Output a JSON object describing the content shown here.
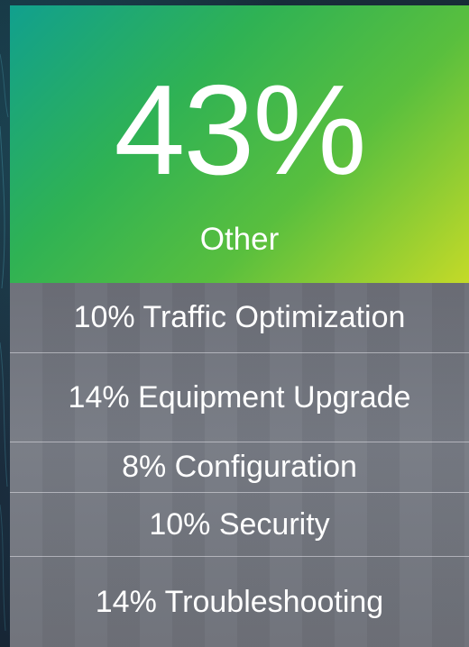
{
  "headline": {
    "value": "43%",
    "label": "Other",
    "gradient_colors": [
      "#11a08e",
      "#2fb254",
      "#59bf3e",
      "#c4da28"
    ]
  },
  "breakdown": [
    {
      "text": "10% Traffic Optimization"
    },
    {
      "text": "14% Equipment Upgrade"
    },
    {
      "text": "8% Configuration"
    },
    {
      "text": "10% Security"
    },
    {
      "text": "14% Troubleshooting"
    }
  ],
  "colors": {
    "text": "#ffffff",
    "list_background": "#74777f",
    "page_background": "#1d2a38"
  }
}
